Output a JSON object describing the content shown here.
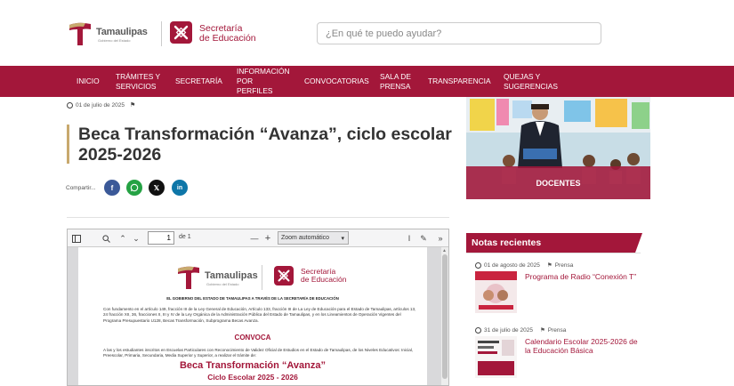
{
  "header": {
    "logo_tamaulipas": "Tamaulipas",
    "logo_tamaulipas_sub": "Gobierno del Estado",
    "logo_secretaria_line1": "Secretaría",
    "logo_secretaria_line2": "de Educación",
    "search_placeholder": "¿En qué te puedo ayudar?"
  },
  "nav": {
    "items": [
      {
        "label": "INICIO"
      },
      {
        "label": "TRÁMITES Y SERVICIOS"
      },
      {
        "label": "SECRETARÍA"
      },
      {
        "label": "INFORMACIÓN POR PERFILES"
      },
      {
        "label": "CONVOCATORIAS"
      },
      {
        "label": "SALA DE PRENSA"
      },
      {
        "label": "TRANSPARENCIA"
      },
      {
        "label": "QUEJAS Y SUGERENCIAS"
      }
    ]
  },
  "article": {
    "date": "01 de julio de 2025",
    "title": "Beca Transformación “Avanza”, ciclo escolar 2025-2026",
    "share_label": "Compartir...",
    "share_icons": [
      "facebook-icon",
      "whatsapp-icon",
      "x-icon",
      "linkedin-icon"
    ]
  },
  "pdf_viewer": {
    "page_number": "1",
    "page_of": "de 1",
    "zoom": "Zoom automático",
    "document": {
      "gov_line": "EL GOBIERNO DEL ESTADO DE TAMAULIPAS A TRAVÉS DE LA SECRETARÍA DE EDUCACIÓN",
      "para1": "Con fundamento en el artículo 149, fracción III de la Ley General de Educación, Artículo 133, fracción III de La Ley de Educación para el Estado de Tamaulipas, artículos 13, 24 fracción XII, 36, fracciones II, III y IV de la Ley Orgánica de la Administración Pública del Estado de Tamaulipas, y en los Lineamientos de Operación Vigentes del Programa Presupuestario U128, Becas Transformación, Subprograma Becas Avanza.",
      "convoca": "CONVOCA",
      "para2": "A las y los estudiantes inscritos en Escuelas Particulares con Reconocimiento de Validez Oficial de Estudios en el Estado de Tamaulipas, de los Niveles Educativos: Inicial, Preescolar, Primaria, Secundaria, Media Superior y Superior, a realizar el trámite de:",
      "beca_title": "Beca Transformación “Avanza”",
      "ciclo": "Ciclo Escolar 2025 - 2026"
    }
  },
  "sidebar": {
    "hero_label": "DOCENTES",
    "notas_title": "Notas recientes",
    "notes": [
      {
        "date": "01 de agosto de 2025",
        "category": "Prensa",
        "title": "Programa de Radio “Conexión T”"
      },
      {
        "date": "31 de julio de 2025",
        "category": "Prensa",
        "title": "Calendario Escolar 2025-2026 de la Educación Básica"
      }
    ]
  },
  "colors": {
    "brand": "#a3173a",
    "accent_gold": "#c8a96e"
  }
}
